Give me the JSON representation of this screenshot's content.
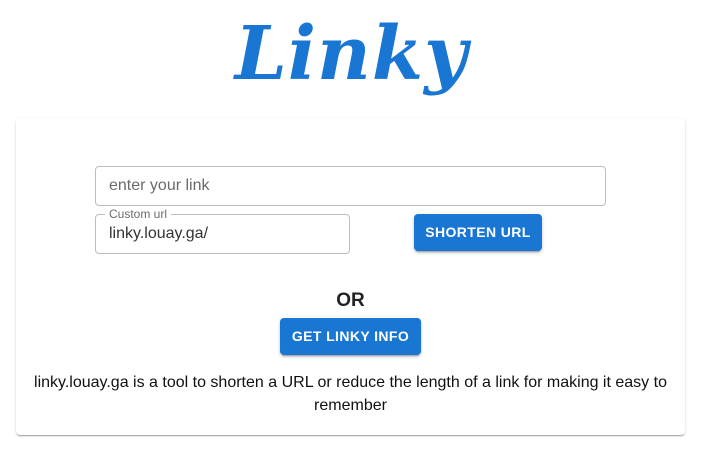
{
  "logo": {
    "text": "Linky",
    "color": "#1976d2"
  },
  "form": {
    "link_input": {
      "value": "",
      "placeholder": "enter your link"
    },
    "custom_url": {
      "label": "Custom url",
      "value": "linky.louay.ga/"
    },
    "shorten_button_label": "SHORTEN URL"
  },
  "divider_text": "OR",
  "info_button_label": "GET LINKY INFO",
  "description": "linky.louay.ga is a tool to shorten a URL or reduce the length of a link for making it easy to remember",
  "colors": {
    "primary": "#1976d2"
  }
}
